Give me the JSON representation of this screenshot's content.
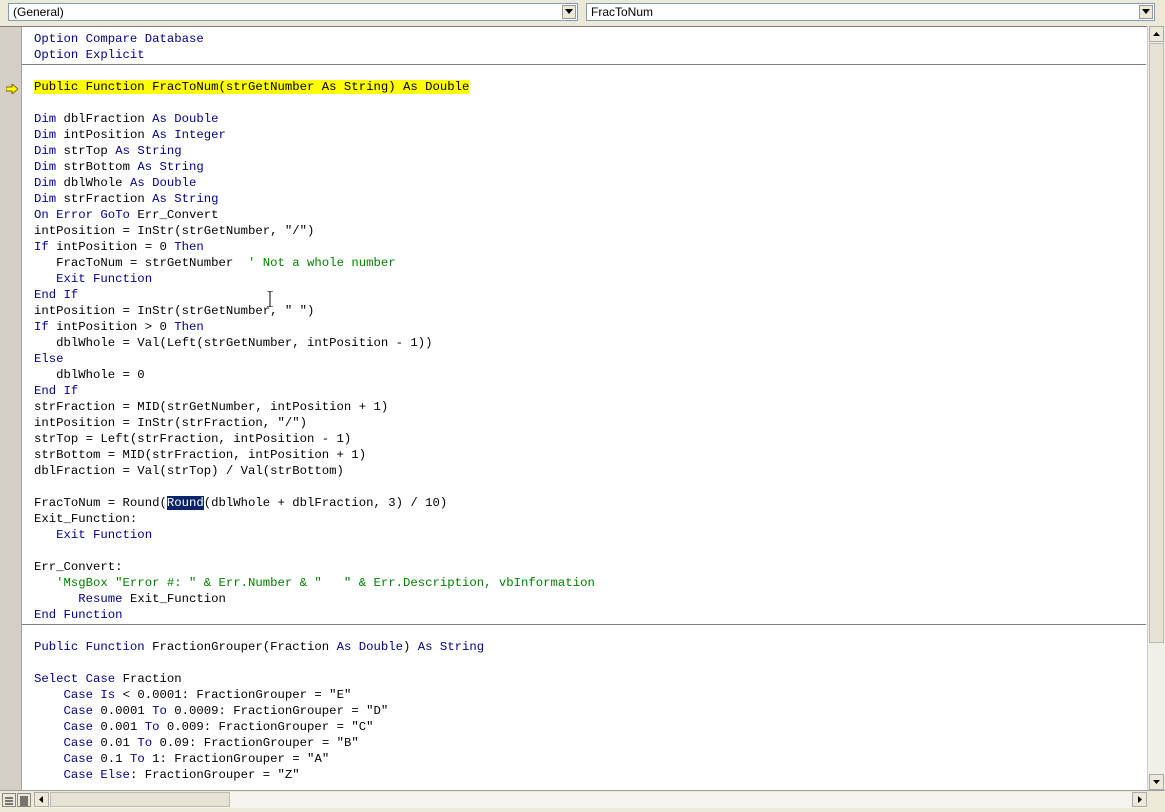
{
  "object_combo": {
    "value": "(General)"
  },
  "procedure_combo": {
    "value": "FracToNum"
  },
  "code_lines": [
    [
      [
        "kw",
        "Option Compare Database"
      ]
    ],
    [
      [
        "kw",
        "Option Explicit"
      ]
    ],
    [],
    [
      [
        "hl",
        "Public Function FracToNum(strGetNumber As String) As Double"
      ]
    ],
    [],
    [
      [
        "kw",
        "Dim "
      ],
      [
        "tx",
        "dblFraction "
      ],
      [
        "kw",
        "As Double"
      ]
    ],
    [
      [
        "kw",
        "Dim "
      ],
      [
        "tx",
        "intPosition "
      ],
      [
        "kw",
        "As Integer"
      ]
    ],
    [
      [
        "kw",
        "Dim "
      ],
      [
        "tx",
        "strTop "
      ],
      [
        "kw",
        "As String"
      ]
    ],
    [
      [
        "kw",
        "Dim "
      ],
      [
        "tx",
        "strBottom "
      ],
      [
        "kw",
        "As String"
      ]
    ],
    [
      [
        "kw",
        "Dim "
      ],
      [
        "tx",
        "dblWhole "
      ],
      [
        "kw",
        "As Double"
      ]
    ],
    [
      [
        "kw",
        "Dim "
      ],
      [
        "tx",
        "strFraction "
      ],
      [
        "kw",
        "As String"
      ]
    ],
    [
      [
        "kw",
        "On Error GoTo "
      ],
      [
        "tx",
        "Err_Convert"
      ]
    ],
    [
      [
        "tx",
        "intPosition = InStr(strGetNumber, \"/\")"
      ]
    ],
    [
      [
        "kw",
        "If "
      ],
      [
        "tx",
        "intPosition = 0 "
      ],
      [
        "kw",
        "Then"
      ]
    ],
    [
      [
        "tx",
        "   FracToNum = strGetNumber  "
      ],
      [
        "cm",
        "' Not a whole number"
      ]
    ],
    [
      [
        "kw",
        "   Exit Function"
      ]
    ],
    [
      [
        "kw",
        "End If"
      ]
    ],
    [
      [
        "tx",
        "intPosition = InStr(strGetNumber, \" \")"
      ]
    ],
    [
      [
        "kw",
        "If "
      ],
      [
        "tx",
        "intPosition > 0 "
      ],
      [
        "kw",
        "Then"
      ]
    ],
    [
      [
        "tx",
        "   dblWhole = Val(Left(strGetNumber, intPosition - 1))"
      ]
    ],
    [
      [
        "kw",
        "Else"
      ]
    ],
    [
      [
        "tx",
        "   dblWhole = 0"
      ]
    ],
    [
      [
        "kw",
        "End If"
      ]
    ],
    [
      [
        "tx",
        "strFraction = MID(strGetNumber, intPosition + 1)"
      ]
    ],
    [
      [
        "tx",
        "intPosition = InStr(strFraction, \"/\")"
      ]
    ],
    [
      [
        "tx",
        "strTop = Left(strFraction, intPosition - 1)"
      ]
    ],
    [
      [
        "tx",
        "strBottom = MID(strFraction, intPosition + 1)"
      ]
    ],
    [
      [
        "tx",
        "dblFraction = Val(strTop) / Val(strBottom)"
      ]
    ],
    [],
    [
      [
        "tx",
        "FracToNum = Round("
      ],
      [
        "sel",
        "Round"
      ],
      [
        "tx",
        "(dblWhole + dblFraction, 3) / 10)"
      ]
    ],
    [
      [
        "tx",
        "Exit_Function:"
      ]
    ],
    [
      [
        "kw",
        "   Exit Function"
      ]
    ],
    [],
    [
      [
        "tx",
        "Err_Convert:"
      ]
    ],
    [
      [
        "cm",
        "   'MsgBox \"Error #: \" & Err.Number & \"   \" & Err.Description, vbInformation"
      ]
    ],
    [
      [
        "kw",
        "      Resume "
      ],
      [
        "tx",
        "Exit_Function"
      ]
    ],
    [
      [
        "kw",
        "End Function"
      ]
    ],
    [],
    [
      [
        "kw",
        "Public Function "
      ],
      [
        "tx",
        "FractionGrouper(Fraction "
      ],
      [
        "kw",
        "As Double"
      ],
      [
        "tx",
        ") "
      ],
      [
        "kw",
        "As String"
      ]
    ],
    [],
    [
      [
        "kw",
        "Select Case "
      ],
      [
        "tx",
        "Fraction"
      ]
    ],
    [
      [
        "kw",
        "    Case Is "
      ],
      [
        "tx",
        "< 0.0001: FractionGrouper = \"E\""
      ]
    ],
    [
      [
        "kw",
        "    Case "
      ],
      [
        "tx",
        "0.0001 "
      ],
      [
        "kw",
        "To "
      ],
      [
        "tx",
        "0.0009: FractionGrouper = \"D\""
      ]
    ],
    [
      [
        "kw",
        "    Case "
      ],
      [
        "tx",
        "0.001 "
      ],
      [
        "kw",
        "To "
      ],
      [
        "tx",
        "0.009: FractionGrouper = \"C\""
      ]
    ],
    [
      [
        "kw",
        "    Case "
      ],
      [
        "tx",
        "0.01 "
      ],
      [
        "kw",
        "To "
      ],
      [
        "tx",
        "0.09: FractionGrouper = \"B\""
      ]
    ],
    [
      [
        "kw",
        "    Case "
      ],
      [
        "tx",
        "0.1 "
      ],
      [
        "kw",
        "To "
      ],
      [
        "tx",
        "1: FractionGrouper = \"A\""
      ]
    ],
    [
      [
        "kw",
        "    Case Else"
      ],
      [
        "tx",
        ": FractionGrouper = \"Z\""
      ]
    ]
  ],
  "colors": {
    "keyword": "#00008b",
    "comment": "#008000",
    "execution_highlight": "#ffff00",
    "selection": "#0a246a"
  },
  "icons": {
    "execution_pointer": "yellow-arrow-icon",
    "dropdown": "chevron-down-icon"
  }
}
